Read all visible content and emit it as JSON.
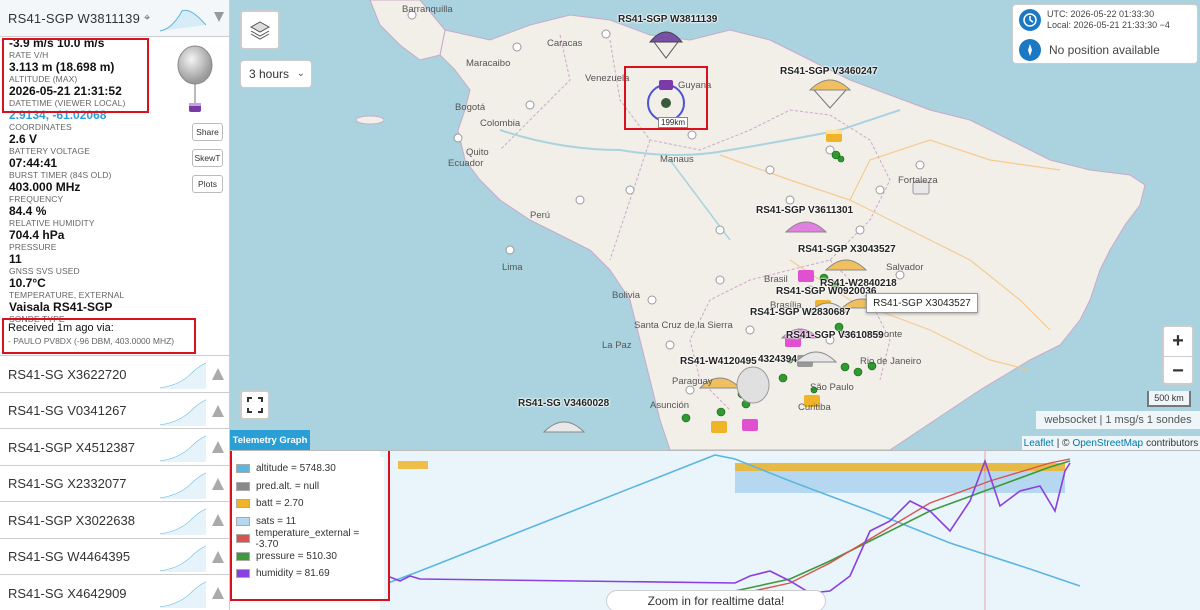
{
  "sidebar": {
    "selected": {
      "name": "RS41-SGP W3811139",
      "fields": [
        {
          "value": "-3.9 m/s 10.0 m/s",
          "label": "RATE V/H"
        },
        {
          "value": "3.113 m (18.698 m)",
          "label": "ALTITUDE (MAX)"
        },
        {
          "value": "2026-05-21 21:31:52",
          "label": "DATETIME (VIEWER LOCAL)"
        },
        {
          "value": "2.9134, -61.02068",
          "label": "COORDINATES"
        },
        {
          "value": "2.6 V",
          "label": "BATTERY VOLTAGE"
        },
        {
          "value": "07:44:41",
          "label": "BURST TIMER (84S OLD)"
        },
        {
          "value": "403.000 MHz",
          "label": "FREQUENCY"
        },
        {
          "value": "84.4 %",
          "label": "RELATIVE HUMIDITY"
        },
        {
          "value": "704.4 hPa",
          "label": "PRESSURE"
        },
        {
          "value": "11",
          "label": "GNSS SVS USED"
        },
        {
          "value": "10.7°C",
          "label": "TEMPERATURE, EXTERNAL"
        },
        {
          "value": "Vaisala RS41-SGP",
          "label": "SONDE TYPE"
        }
      ],
      "buttons": {
        "share": "Share",
        "skewt": "SkewT",
        "plots": "Plots"
      },
      "received_line1": "Received 1m ago via:",
      "received_line2": "- PAULO PV8DX (-96 DBM, 403.0000 MHZ)"
    },
    "sondes": [
      {
        "name": "RS41-SG X3622720"
      },
      {
        "name": "RS41-SG V0341267"
      },
      {
        "name": "RS41-SGP X4512387"
      },
      {
        "name": "RS41-SG X2332077"
      },
      {
        "name": "RS41-SGP X3022638"
      },
      {
        "name": "RS41-SG W4464395"
      },
      {
        "name": "RS41-SG X4642909"
      }
    ]
  },
  "map": {
    "hours_select": "3 hours",
    "utc_line": "UTC: 2026-05-22 01:33:30",
    "local_line": "Local: 2026-05-21 21:33:30 −4",
    "position_status": "No position available",
    "tooltip": "RS41-SGP X3043527",
    "range_label": "199km",
    "scale": "500 km",
    "ws_status": "websocket | 1 msg/s 1 sondes",
    "attribution_leaflet": "Leaflet",
    "attribution_sep": "| ©",
    "attribution_osm": "OpenStreetMap",
    "attribution_tail": "contributors",
    "zoom_in": "+",
    "zoom_out": "−",
    "sonde_labels": [
      "RS41-SGP W3811139",
      "RS41-SGP V3460247",
      "RS41-SGP V3611301",
      "RS41-SGP X3043527",
      "RS41-W2840218",
      "RS41-SGP W0920036",
      "RS41-SGP W2830687",
      "RS41-SGP V3610859",
      "RS41-W4120495",
      "4324394",
      "RS41-SG V3460028"
    ],
    "places": [
      "Barranquilla",
      "Maracaibo",
      "Caracas",
      "Venezuela",
      "Bogotá",
      "Colombia",
      "Quito",
      "Ecuador",
      "Guyana",
      "Manaus",
      "Fortaleza",
      "Brasil",
      "Lima",
      "Perú",
      "Bolivia",
      "La Paz",
      "Santa Cruz de la Sierra",
      "Paraguay",
      "Asunción",
      "Salvador",
      "Brasília",
      "Rio de Janeiro",
      "São Paulo",
      "Curitiba",
      "Belo Horizonte"
    ]
  },
  "telemetry": {
    "tab_title": "Telemetry Graph",
    "legend": [
      {
        "text": "altitude = 5748.30",
        "color": "#5bb6e0"
      },
      {
        "text": "pred.alt. = null",
        "color": "#888888"
      },
      {
        "text": "batt = 2.70",
        "color": "#f0b429"
      },
      {
        "text": "sats = 11",
        "color": "#b5d8f0"
      },
      {
        "text": "temperature_external = -3.70",
        "color": "#d9534f"
      },
      {
        "text": "pressure = 510.30",
        "color": "#3c9a3c"
      },
      {
        "text": "humidity = 81.69",
        "color": "#8a3fe0"
      }
    ],
    "zoom_message": "Zoom in for realtime data!"
  }
}
